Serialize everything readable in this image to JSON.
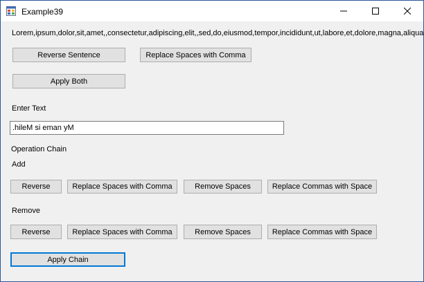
{
  "window": {
    "title": "Example39"
  },
  "lorem_text": "Lorem,ipsum,dolor,sit,amet,,consectetur,adipiscing,elit,,sed,do,eiusmod,tempor,incididunt,ut,labore,et,dolore,magna,aliqua.",
  "buttons": {
    "reverse_sentence": "Reverse Sentence",
    "replace_spaces_comma": "Replace Spaces with Comma",
    "apply_both": "Apply Both",
    "apply_chain": "Apply Chain"
  },
  "enter_text": {
    "label": "Enter Text",
    "value": ".hileM si eman yM"
  },
  "operation_chain": {
    "label": "Operation Chain",
    "add": {
      "label": "Add",
      "buttons": [
        "Reverse",
        "Replace Spaces with Comma",
        "Remove Spaces",
        "Replace Commas with Space"
      ]
    },
    "remove": {
      "label": "Remove",
      "buttons": [
        "Reverse",
        "Replace Spaces with Comma",
        "Remove Spaces",
        "Replace Commas with Space"
      ]
    }
  },
  "colors": {
    "accent": "#0078d7",
    "button_bg": "#e1e1e1",
    "window_bg": "#f0f0f0"
  },
  "icons": [
    "app-icon",
    "minimize-icon",
    "maximize-icon",
    "close-icon"
  ]
}
